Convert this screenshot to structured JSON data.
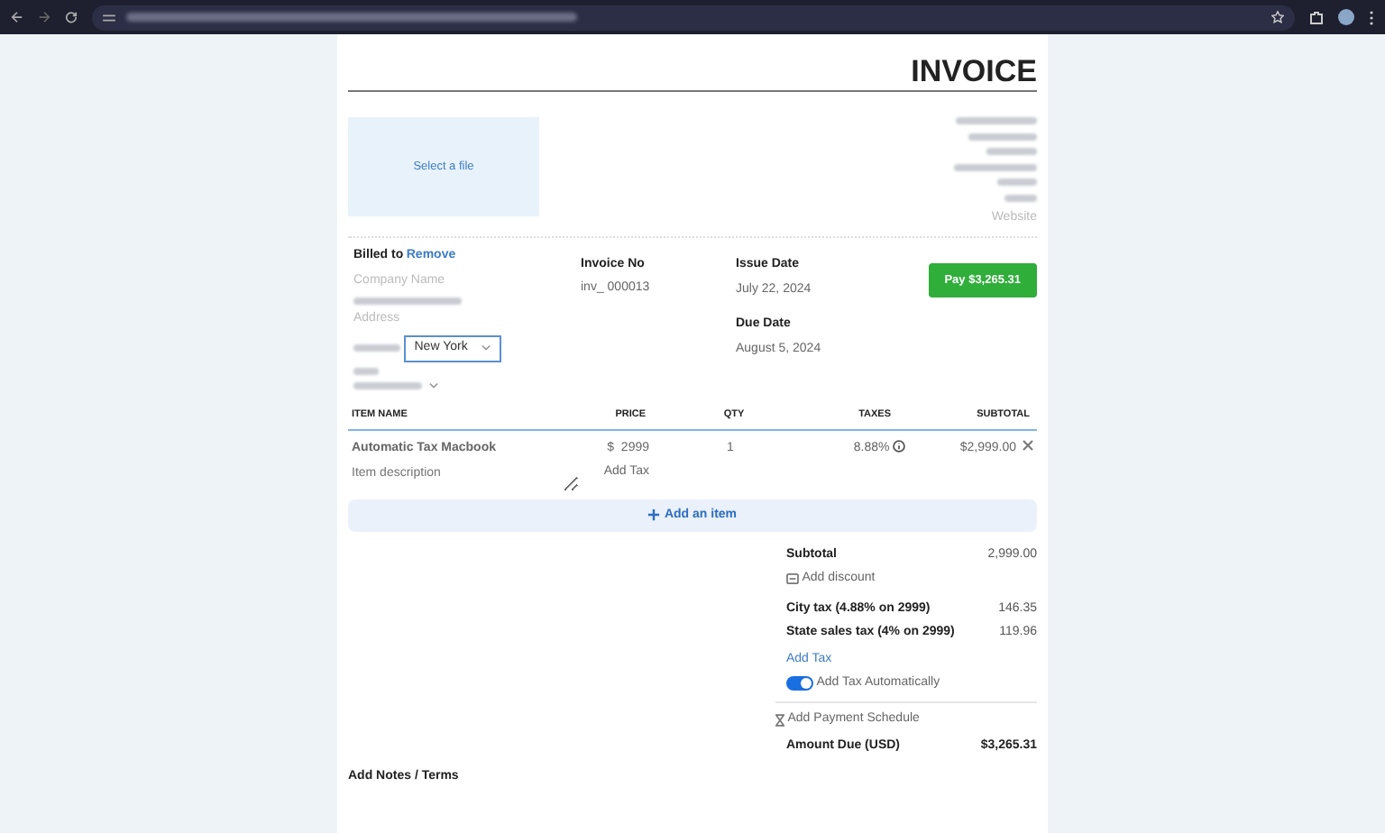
{
  "invoice": {
    "title": "INVOICE",
    "logo_upload": "Select a file",
    "website_placeholder": "Website",
    "billed_to": {
      "label": "Billed to",
      "remove_link": "Remove",
      "company_placeholder": "Company Name",
      "address_placeholder": "Address",
      "city": "New York"
    },
    "invoice_no": {
      "label": "Invoice No",
      "prefix": "inv_",
      "number": "000013"
    },
    "issue_date": {
      "label": "Issue Date",
      "value": "July 22, 2024"
    },
    "due_date": {
      "label": "Due Date",
      "value": "August 5, 2024"
    },
    "pay_button": "Pay $3,265.31",
    "table": {
      "columns": [
        "ITEM NAME",
        "PRICE",
        "QTY",
        "TAXES",
        "SUBTOTAL"
      ],
      "rows": [
        {
          "name": "Automatic Tax Macbook",
          "description_placeholder": "Item description",
          "currency": "$",
          "price": "2999",
          "add_tax": "Add Tax",
          "qty": "1",
          "taxes": "8.88%",
          "subtotal": "$2,999.00"
        }
      ]
    },
    "add_item": "Add an item",
    "summary": {
      "subtotal_label": "Subtotal",
      "subtotal_value": "2,999.00",
      "add_discount": "Add discount",
      "taxes": [
        {
          "label": "City tax (4.88% on 2999)",
          "value": "146.35"
        },
        {
          "label": "State sales tax (4% on 2999)",
          "value": "119.96"
        }
      ],
      "add_tax_link": "Add Tax",
      "auto_tax": {
        "label": "Add Tax Automatically",
        "on": true
      },
      "payment_schedule": "Add Payment Schedule",
      "amount_due_label": "Amount Due (USD)",
      "amount_due_value": "$3,265.31"
    },
    "notes_label": "Add Notes / Terms"
  }
}
